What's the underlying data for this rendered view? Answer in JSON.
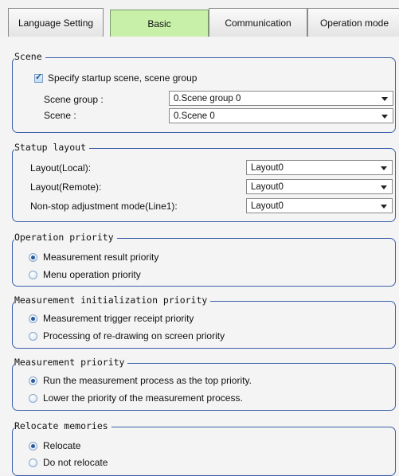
{
  "tabs": [
    {
      "label": "Language Setting"
    },
    {
      "label": "Basic"
    },
    {
      "label": "Communication"
    },
    {
      "label": "Operation mode"
    }
  ],
  "scene": {
    "legend": "Scene",
    "specify_checkbox": {
      "label": "Specify startup scene, scene group",
      "checked": true
    },
    "scene_group": {
      "label": "Scene group :",
      "value": "0.Scene group 0"
    },
    "scene": {
      "label": "Scene :",
      "value": "0.Scene 0"
    }
  },
  "startup_layout": {
    "legend": "Statup layout",
    "layout_local": {
      "label": "Layout(Local):",
      "value": "Layout0"
    },
    "layout_remote": {
      "label": "Layout(Remote):",
      "value": "Layout0"
    },
    "nonstop": {
      "label": "Non-stop adjustment mode(Line1):",
      "value": "Layout0"
    }
  },
  "operation_priority": {
    "legend": "Operation priority",
    "options": [
      {
        "label": "Measurement result priority",
        "selected": true
      },
      {
        "label": "Menu operation priority",
        "selected": false
      }
    ]
  },
  "measurement_init_priority": {
    "legend": "Measurement initialization priority",
    "options": [
      {
        "label": "Measurement trigger receipt priority",
        "selected": true
      },
      {
        "label": "Processing of re-drawing on screen priority",
        "selected": false
      }
    ]
  },
  "measurement_priority": {
    "legend": "Measurement priority",
    "options": [
      {
        "label": "Run the measurement process as the top priority.",
        "selected": true
      },
      {
        "label": "Lower the priority of the measurement process.",
        "selected": false
      }
    ]
  },
  "relocate_memories": {
    "legend": "Relocate memories",
    "options": [
      {
        "label": "Relocate",
        "selected": true
      },
      {
        "label": "Do not relocate",
        "selected": false
      }
    ]
  }
}
